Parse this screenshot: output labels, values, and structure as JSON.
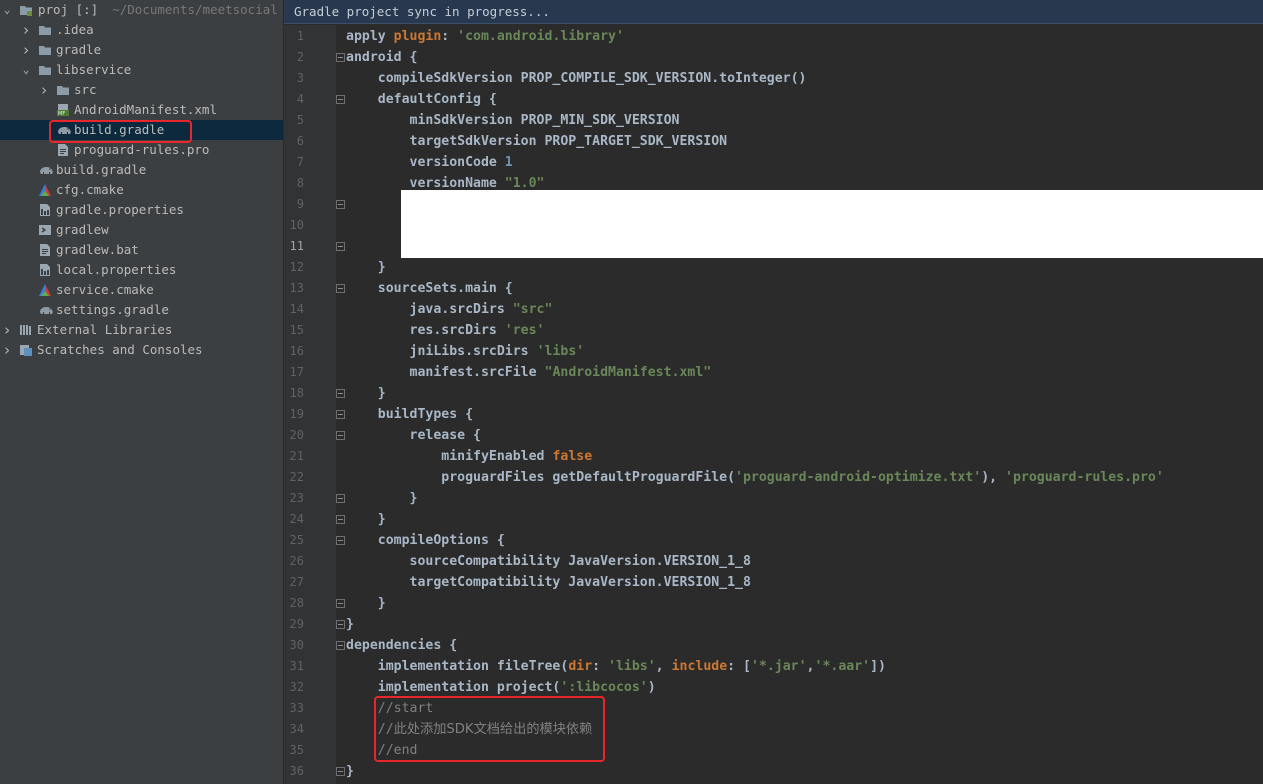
{
  "sidebar": {
    "root": {
      "label": "proj [:]",
      "path": "~/Documents/meetsocial"
    },
    "items": [
      {
        "label": ".idea",
        "icon": "folder-icon",
        "depth": 1,
        "arrow": "collapsed"
      },
      {
        "label": "gradle",
        "icon": "folder-icon",
        "depth": 1,
        "arrow": "collapsed"
      },
      {
        "label": "libservice",
        "icon": "folder-icon",
        "depth": 1,
        "arrow": "expanded"
      },
      {
        "label": "src",
        "icon": "folder-icon",
        "depth": 2,
        "arrow": "collapsed"
      },
      {
        "label": "AndroidManifest.xml",
        "icon": "manifest-icon",
        "depth": 2,
        "arrow": "none"
      },
      {
        "label": "build.gradle",
        "icon": "gradle-elephant-icon",
        "depth": 2,
        "arrow": "none",
        "selected": true
      },
      {
        "label": "proguard-rules.pro",
        "icon": "text-file-icon",
        "depth": 2,
        "arrow": "none"
      },
      {
        "label": "build.gradle",
        "icon": "gradle-elephant-icon",
        "depth": 1,
        "arrow": "none"
      },
      {
        "label": "cfg.cmake",
        "icon": "cmake-icon",
        "depth": 1,
        "arrow": "none"
      },
      {
        "label": "gradle.properties",
        "icon": "properties-file-icon",
        "depth": 1,
        "arrow": "none"
      },
      {
        "label": "gradlew",
        "icon": "shell-script-icon",
        "depth": 1,
        "arrow": "none"
      },
      {
        "label": "gradlew.bat",
        "icon": "text-file-icon",
        "depth": 1,
        "arrow": "none"
      },
      {
        "label": "local.properties",
        "icon": "properties-file-icon",
        "depth": 1,
        "arrow": "none"
      },
      {
        "label": "service.cmake",
        "icon": "cmake-icon",
        "depth": 1,
        "arrow": "none"
      },
      {
        "label": "settings.gradle",
        "icon": "gradle-elephant-icon",
        "depth": 1,
        "arrow": "none"
      },
      {
        "label": "External Libraries",
        "icon": "library-icon",
        "depth": 0,
        "arrow": "collapsed"
      },
      {
        "label": "Scratches and Consoles",
        "icon": "scratches-icon",
        "depth": 0,
        "arrow": "collapsed"
      }
    ]
  },
  "editor": {
    "notice": "Gradle project sync in progress...",
    "current_line": 11,
    "lines": [
      {
        "n": "1",
        "seg": [
          [
            "plain",
            "apply "
          ],
          [
            "kw",
            "plugin"
          ],
          [
            "plain",
            ": "
          ],
          [
            "str",
            "'com.android.library'"
          ]
        ]
      },
      {
        "n": "2",
        "seg": [
          [
            "plain",
            "android {"
          ]
        ],
        "fold": true
      },
      {
        "n": "3",
        "seg": [
          [
            "plain",
            "    compileSdkVersion PROP_COMPILE_SDK_VERSION.toInteger()"
          ]
        ]
      },
      {
        "n": "4",
        "seg": [
          [
            "plain",
            "    defaultConfig {"
          ]
        ],
        "fold": true
      },
      {
        "n": "5",
        "seg": [
          [
            "plain",
            "        minSdkVersion PROP_MIN_SDK_VERSION"
          ]
        ]
      },
      {
        "n": "6",
        "seg": [
          [
            "plain",
            "        targetSdkVersion PROP_TARGET_SDK_VERSION"
          ]
        ]
      },
      {
        "n": "7",
        "seg": [
          [
            "plain",
            "        versionCode "
          ],
          [
            "num",
            "1"
          ]
        ]
      },
      {
        "n": "8",
        "seg": [
          [
            "plain",
            "        versionName "
          ],
          [
            "str",
            "\"1.0\""
          ]
        ]
      },
      {
        "n": "9",
        "seg": [],
        "fold": true
      },
      {
        "n": "10",
        "seg": []
      },
      {
        "n": "11",
        "seg": [],
        "fold": true
      },
      {
        "n": "12",
        "seg": [
          [
            "plain",
            "    }"
          ]
        ]
      },
      {
        "n": "13",
        "seg": [
          [
            "plain",
            "    sourceSets.main {"
          ]
        ],
        "fold": true
      },
      {
        "n": "14",
        "seg": [
          [
            "plain",
            "        java.srcDirs "
          ],
          [
            "str",
            "\"src\""
          ]
        ]
      },
      {
        "n": "15",
        "seg": [
          [
            "plain",
            "        res.srcDirs "
          ],
          [
            "str",
            "'res'"
          ]
        ]
      },
      {
        "n": "16",
        "seg": [
          [
            "plain",
            "        jniLibs.srcDirs "
          ],
          [
            "str",
            "'libs'"
          ]
        ]
      },
      {
        "n": "17",
        "seg": [
          [
            "plain",
            "        manifest.srcFile "
          ],
          [
            "str",
            "\"AndroidManifest.xml\""
          ]
        ]
      },
      {
        "n": "18",
        "seg": [
          [
            "plain",
            "    }"
          ]
        ],
        "fold": true
      },
      {
        "n": "19",
        "seg": [
          [
            "plain",
            "    buildTypes {"
          ]
        ],
        "fold": true
      },
      {
        "n": "20",
        "seg": [
          [
            "plain",
            "        release {"
          ]
        ],
        "fold": true
      },
      {
        "n": "21",
        "seg": [
          [
            "plain",
            "            minifyEnabled "
          ],
          [
            "kw",
            "false"
          ]
        ]
      },
      {
        "n": "22",
        "seg": [
          [
            "plain",
            "            proguardFiles getDefaultProguardFile("
          ],
          [
            "str",
            "'proguard-android-optimize.txt'"
          ],
          [
            "plain",
            "), "
          ],
          [
            "str",
            "'proguard-rules.pro'"
          ]
        ]
      },
      {
        "n": "23",
        "seg": [
          [
            "plain",
            "        }"
          ]
        ],
        "fold": true
      },
      {
        "n": "24",
        "seg": [
          [
            "plain",
            "    }"
          ]
        ],
        "fold": true
      },
      {
        "n": "25",
        "seg": [
          [
            "plain",
            "    compileOptions {"
          ]
        ],
        "fold": true
      },
      {
        "n": "26",
        "seg": [
          [
            "plain",
            "        sourceCompatibility JavaVersion.VERSION_1_8"
          ]
        ]
      },
      {
        "n": "27",
        "seg": [
          [
            "plain",
            "        targetCompatibility JavaVersion.VERSION_1_8"
          ]
        ]
      },
      {
        "n": "28",
        "seg": [
          [
            "plain",
            "    }"
          ]
        ],
        "fold": true
      },
      {
        "n": "29",
        "seg": [
          [
            "plain",
            "}"
          ]
        ],
        "fold": true
      },
      {
        "n": "30",
        "seg": [
          [
            "plain",
            "dependencies {"
          ]
        ],
        "fold": true
      },
      {
        "n": "31",
        "seg": [
          [
            "plain",
            "    implementation fileTree("
          ],
          [
            "kw",
            "dir"
          ],
          [
            "plain",
            ": "
          ],
          [
            "str",
            "'libs'"
          ],
          [
            "plain",
            ", "
          ],
          [
            "kw",
            "include"
          ],
          [
            "plain",
            ": ["
          ],
          [
            "str",
            "'*.jar'"
          ],
          [
            "plain",
            ","
          ],
          [
            "str",
            "'*.aar'"
          ],
          [
            "plain",
            "])"
          ]
        ]
      },
      {
        "n": "32",
        "seg": [
          [
            "plain",
            "    implementation project("
          ],
          [
            "str",
            "':libcocos'"
          ],
          [
            "plain",
            ")"
          ]
        ]
      },
      {
        "n": "33",
        "seg": [
          [
            "cmt",
            "    //start"
          ]
        ]
      },
      {
        "n": "34",
        "seg": [
          [
            "cmt",
            "    //"
          ],
          [
            "cmt-cjk",
            "此处添加SDK文档给出的模块依赖"
          ]
        ]
      },
      {
        "n": "35",
        "seg": [
          [
            "cmt",
            "    //end"
          ]
        ]
      },
      {
        "n": "36",
        "seg": [
          [
            "plain",
            "}"
          ]
        ],
        "fold": true
      }
    ]
  },
  "colors": {
    "sidebar_bg": "#3c3f41",
    "editor_bg": "#2b2b2b",
    "keyword": "#cc7832",
    "string": "#6a8759",
    "number": "#6897bb",
    "comment": "#808080",
    "highlight_box": "#e8262b"
  }
}
